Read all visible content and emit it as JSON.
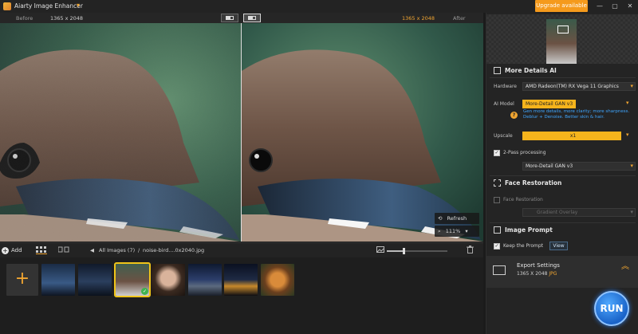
{
  "app": {
    "title": "Aiarty Image Enhancer",
    "upgrade_label": "Upgrade available",
    "window_controls": [
      "minimize",
      "maximize",
      "close"
    ]
  },
  "compare_bar": {
    "before_label": "Before",
    "before_size": "1365 x 2048",
    "after_size": "1365 x 2048",
    "after_label": "After"
  },
  "image_tools": {
    "refresh_label": "Refresh",
    "zoom_value": "111%"
  },
  "bottom_bar": {
    "add_label": "Add",
    "breadcrumb_all": "All Images (7)",
    "breadcrumb_sep": "/",
    "breadcrumb_file": "noise-bird....0x2040.jpg"
  },
  "zoom_slider_fraction": 0.27,
  "thumbnails": [
    {
      "name": "thumb-sky",
      "selected": false
    },
    {
      "name": "thumb-sky-dark",
      "selected": false
    },
    {
      "name": "thumb-bird",
      "selected": true
    },
    {
      "name": "thumb-woman",
      "selected": false
    },
    {
      "name": "thumb-mountain",
      "selected": false
    },
    {
      "name": "thumb-city-night",
      "selected": false
    },
    {
      "name": "thumb-tiger",
      "selected": false
    }
  ],
  "panel": {
    "more_details": {
      "title": "More Details AI",
      "hardware_label": "Hardware",
      "hardware_value": "AMD Radeon(TM) RX Vega 11 Graphics",
      "ai_model_label": "AI Model",
      "ai_model_value": "More-Detail GAN  v3",
      "ai_model_hint": "Gen more details, more clarity; more sharpness. Deblur + Denoise. Better skin & hair.",
      "upscale_label": "Upscale",
      "upscale_value": "x1",
      "two_pass_label": "2-Pass processing",
      "two_pass_model": "More-Detail GAN  v3"
    },
    "face_restoration": {
      "title": "Face Restoration",
      "checkbox_label": "Face Restoration",
      "select_value": "Gradient Overlay"
    },
    "image_prompt": {
      "title": "Image Prompt",
      "keep_label": "Keep the Prompt",
      "view_label": "View"
    },
    "export": {
      "title": "Export Settings",
      "size": "1365 X 2048",
      "format": "JPG"
    },
    "run_label": "RUN"
  },
  "colors": {
    "accent": "#f0a531",
    "run_blue": "#2f7ae0",
    "hint_blue": "#3fa6ff",
    "background": "#1b1b1b"
  }
}
